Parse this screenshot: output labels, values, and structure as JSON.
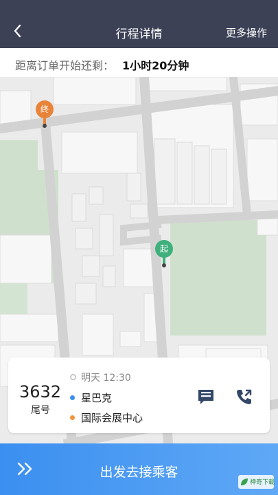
{
  "header": {
    "title": "行程详情",
    "more_label": "更多操作",
    "back_icon": "chevron-left-icon"
  },
  "countdown": {
    "label": "距离订单开始还剩：",
    "value": "1小时20分钟"
  },
  "map": {
    "end_pin_label": "终",
    "start_pin_label": "起",
    "end_pin_color": "#e8843a",
    "start_pin_color": "#3fb07d",
    "park_color": "#cfe1cc"
  },
  "trip": {
    "tail_number": "3632",
    "tail_label": "尾号",
    "time": "明天 12:30",
    "from": "星巴克",
    "to": "国际会展中心",
    "from_dot_color": "#3b8ff0",
    "to_dot_color": "#f0963a",
    "message_icon": "message-icon",
    "call_icon": "phone-icon"
  },
  "action": {
    "label": "出发去接乘客",
    "arrow_icon": "double-chevron-right-icon"
  },
  "watermark": {
    "text": "神奇下载"
  }
}
